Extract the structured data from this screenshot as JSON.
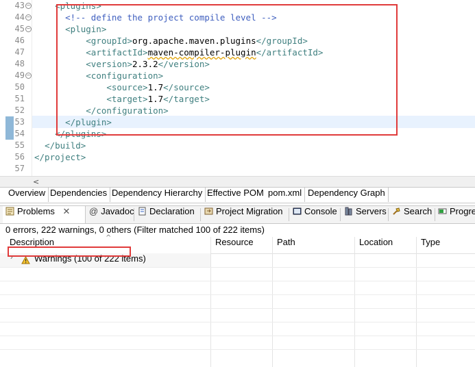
{
  "editor": {
    "lines": [
      {
        "n": "43",
        "fold": true,
        "html": "<span class='tag'>&lt;plugins&gt;</span>",
        "indent": "    "
      },
      {
        "n": "44",
        "fold": true,
        "html": "<span class='cmt'>&lt;!-- define the project compile level --&gt;</span>",
        "indent": "      "
      },
      {
        "n": "45",
        "fold": true,
        "html": "<span class='tag'>&lt;plugin&gt;</span>",
        "indent": "      "
      },
      {
        "n": "46",
        "fold": false,
        "html": "<span class='tag'>&lt;groupId&gt;</span><span class='txt'>org.apache.maven.plugins</span><span class='tag'>&lt;/groupId&gt;</span>",
        "indent": "          "
      },
      {
        "n": "47",
        "fold": false,
        "html": "<span class='tag'>&lt;artifactId&gt;</span><span class='txt squig'>maven-compiler-plugin</span><span class='tag'>&lt;/artifactId&gt;</span>",
        "indent": "          "
      },
      {
        "n": "48",
        "fold": false,
        "html": "<span class='tag'>&lt;version&gt;</span><span class='txt'>2.3.2</span><span class='tag'>&lt;/version&gt;</span>",
        "indent": "          "
      },
      {
        "n": "49",
        "fold": true,
        "html": "<span class='tag'>&lt;configuration&gt;</span>",
        "indent": "          "
      },
      {
        "n": "50",
        "fold": false,
        "html": "<span class='tag'>&lt;source&gt;</span><span class='txt'>1.7</span><span class='tag'>&lt;/source&gt;</span>",
        "indent": "              "
      },
      {
        "n": "51",
        "fold": false,
        "html": "<span class='tag'>&lt;target&gt;</span><span class='txt'>1.7</span><span class='tag'>&lt;/target&gt;</span>",
        "indent": "              "
      },
      {
        "n": "52",
        "fold": false,
        "html": "<span class='tag'>&lt;/configuration&gt;</span>",
        "indent": "          "
      },
      {
        "n": "53",
        "fold": false,
        "html": "<span class='tag'>&lt;/plugin&gt;</span>",
        "indent": "      "
      },
      {
        "n": "54",
        "fold": false,
        "html": "<span class='tag'>&lt;/plugins&gt;</span>",
        "indent": "    "
      },
      {
        "n": "55",
        "fold": false,
        "html": "<span class='tag'>&lt;/build&gt;</span>",
        "indent": "  "
      },
      {
        "n": "56",
        "fold": false,
        "html": "<span class='tag'>&lt;/project&gt;</span>",
        "indent": ""
      },
      {
        "n": "57",
        "fold": false,
        "html": "",
        "indent": ""
      }
    ],
    "colors": {
      "tag": "#3f7f7f",
      "comment": "#3f5fbf",
      "text": "#000000",
      "highlight": "#e03a3a"
    }
  },
  "editor_tabs": [
    "Overview",
    "Dependencies",
    "Dependency Hierarchy",
    "Effective POM",
    "pom.xml",
    "Dependency Graph"
  ],
  "view_tabs": [
    {
      "label": "Problems",
      "icon": "problems-icon",
      "active": true
    },
    {
      "label": "Javadoc",
      "icon": "javadoc-icon"
    },
    {
      "label": "Declaration",
      "icon": "declaration-icon"
    },
    {
      "label": "Project Migration",
      "icon": "migration-icon"
    },
    {
      "label": "Console",
      "icon": "console-icon"
    },
    {
      "label": "Servers",
      "icon": "servers-icon"
    },
    {
      "label": "Search",
      "icon": "search-icon"
    },
    {
      "label": "Progre",
      "icon": "progress-icon"
    }
  ],
  "problems": {
    "summary": "0 errors, 222 warnings, 0 others (Filter matched 100 of 222 items)",
    "columns": [
      "Description",
      "Resource",
      "Path",
      "Location",
      "Type"
    ],
    "rows": [
      {
        "label": "Warnings (100 of 222 items)"
      }
    ]
  }
}
